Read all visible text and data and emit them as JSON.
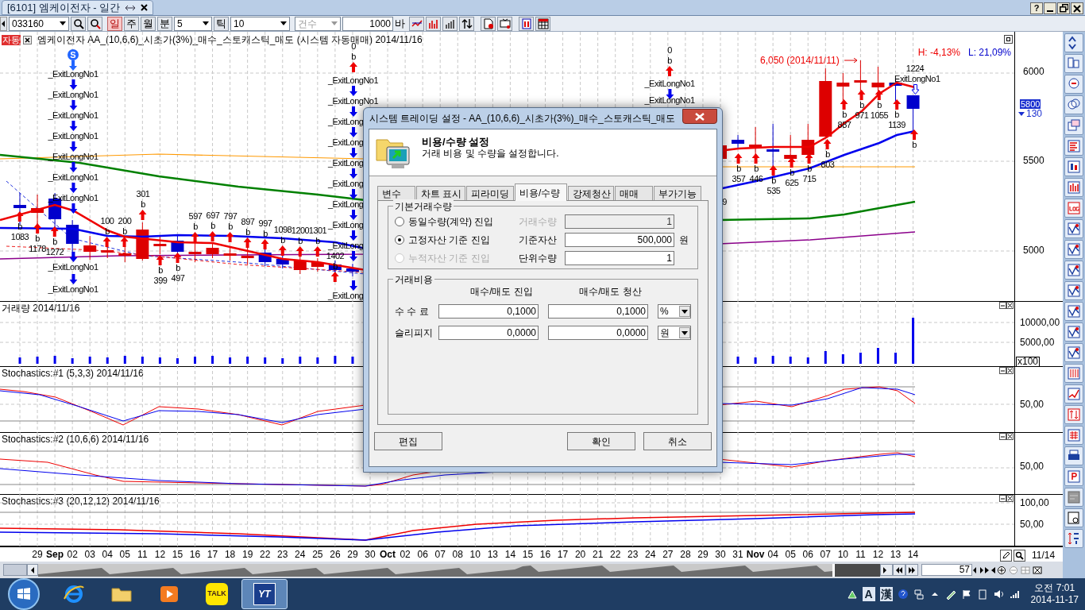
{
  "window": {
    "title": "[6101] 엠케이전자 - 일간",
    "help": "?"
  },
  "toolbar": {
    "code": "033160",
    "periods": [
      {
        "label": "일",
        "selected": true
      },
      {
        "label": "주",
        "selected": false
      },
      {
        "label": "월",
        "selected": false
      },
      {
        "label": "분",
        "selected": false
      }
    ],
    "minute": "5",
    "tick_label": "틱",
    "tick": "10",
    "count_mode": {
      "label": "건수",
      "disabled": true
    },
    "bars": "1000",
    "bars_unit": "바"
  },
  "chart": {
    "badge": "자동",
    "title": "엠케이전자 AA_(10,6,6)_시초가(3%)_매수_스토캐스틱_매도 (시스템 자동매매) 2014/11/16",
    "high": "H: -4,13%",
    "low": "L: 21,09%",
    "peak": "6,050 (2014/11/11)",
    "price_ticks": [
      "6000",
      "5500",
      "5000"
    ],
    "last_price": "5800",
    "change": "130",
    "annotations": [
      {
        "kind": "start",
        "texts": [
          "S"
        ]
      },
      {
        "kind": "exit_above",
        "texts": [
          "_ExitLongNo1"
        ]
      },
      {
        "kind": "exit_above",
        "texts": [
          "_ExitLongNo1"
        ]
      },
      {
        "kind": "exit_above",
        "texts": [
          "_ExitLongNo1"
        ]
      },
      {
        "kind": "exit_above",
        "texts": [
          "_ExitLongNo1"
        ]
      },
      {
        "kind": "exit_above",
        "texts": [
          "_ExitLongNo1"
        ]
      },
      {
        "kind": "exit_above",
        "texts": [
          "_ExitLongNo1"
        ]
      },
      {
        "kind": "exit_above",
        "texts": [
          "_ExitLongNo1"
        ]
      },
      {
        "kind": "exit_below",
        "texts": [
          "_ExitLongNo1"
        ]
      },
      {
        "kind": "exit_below",
        "texts": [
          "_ExitLongNo1"
        ]
      },
      {
        "kind": "buy_below",
        "texts": [
          "b",
          "1083"
        ]
      },
      {
        "kind": "buy_below",
        "texts": [
          "b",
          "1178"
        ]
      },
      {
        "kind": "buy_below",
        "texts": [
          "b",
          "1272"
        ]
      },
      {
        "kind": "buy_above",
        "texts": [
          "100",
          "b"
        ]
      },
      {
        "kind": "buy_above",
        "texts": [
          "200",
          "b"
        ]
      },
      {
        "kind": "buy_above",
        "texts": [
          "301",
          "b"
        ]
      },
      {
        "kind": "buy_below",
        "texts": [
          "b",
          "399"
        ]
      },
      {
        "kind": "buy_below",
        "texts": [
          "b",
          "497"
        ]
      },
      {
        "kind": "buy_above",
        "texts": [
          "597",
          "b"
        ]
      },
      {
        "kind": "buy_above",
        "texts": [
          "697",
          "b"
        ]
      },
      {
        "kind": "buy_above",
        "texts": [
          "797",
          "b"
        ]
      },
      {
        "kind": "buy_above",
        "texts": [
          "897",
          "b"
        ]
      },
      {
        "kind": "buy_above",
        "texts": [
          "997",
          "b"
        ]
      },
      {
        "kind": "buy_above",
        "texts": [
          "1098",
          "b"
        ]
      },
      {
        "kind": "buy_above",
        "texts": [
          "1200",
          "b"
        ]
      },
      {
        "kind": "buy_above",
        "texts": [
          "1301",
          "b"
        ]
      },
      {
        "kind": "buy_above",
        "texts": [
          "1402",
          "b"
        ]
      },
      {
        "kind": "buy_above",
        "texts": [
          "0",
          "b"
        ]
      },
      {
        "kind": "exit_above",
        "texts": [
          "_ExitLongNo1"
        ]
      },
      {
        "kind": "exit_above",
        "texts": [
          "_ExitLongNo1"
        ]
      },
      {
        "kind": "exit_above",
        "texts": [
          "_ExitLong"
        ]
      },
      {
        "kind": "exit_above",
        "texts": [
          "_ExitLong"
        ]
      },
      {
        "kind": "exit_above",
        "texts": [
          "_ExitLong"
        ]
      },
      {
        "kind": "exit_above",
        "texts": [
          "_ExitLong"
        ]
      },
      {
        "kind": "exit_above",
        "texts": [
          "_ExitLong"
        ]
      },
      {
        "kind": "exit_above",
        "texts": [
          "_ExitLong"
        ]
      },
      {
        "kind": "exit_above",
        "texts": [
          "_ExitLong"
        ]
      },
      {
        "kind": "exit_below",
        "texts": [
          "_ExitLong"
        ]
      },
      {
        "kind": "buy_above",
        "texts": [
          "0",
          "b"
        ]
      },
      {
        "kind": "exit_above",
        "texts": [
          "_ExitLongNo1"
        ]
      },
      {
        "kind": "label",
        "texts": [
          "_ExitLongNo1"
        ]
      },
      {
        "kind": "label",
        "texts": [
          "9"
        ]
      },
      {
        "kind": "buy_below",
        "texts": [
          "b",
          "357"
        ]
      },
      {
        "kind": "buy_below",
        "texts": [
          "b",
          "446"
        ]
      },
      {
        "kind": "buy_below",
        "texts": [
          "b",
          "535"
        ]
      },
      {
        "kind": "buy_below",
        "texts": [
          "b",
          "625"
        ]
      },
      {
        "kind": "buy_below",
        "texts": [
          "b",
          "715"
        ]
      },
      {
        "kind": "buy_below",
        "texts": [
          "b",
          "803"
        ]
      },
      {
        "kind": "buy_below",
        "texts": [
          "b",
          "887"
        ]
      },
      {
        "kind": "buy_below",
        "texts": [
          "b",
          "971"
        ]
      },
      {
        "kind": "buy_below",
        "texts": [
          "b",
          "1055"
        ]
      },
      {
        "kind": "buy_below",
        "texts": [
          "b",
          "1139"
        ]
      },
      {
        "kind": "exit_hollow",
        "texts": [
          "1224",
          "_ExitLongNo1"
        ]
      },
      {
        "kind": "buy_below",
        "texts": [
          "b"
        ]
      }
    ]
  },
  "panels": [
    {
      "title": "거래량 2014/11/16",
      "ticks": [
        "10000,00",
        "5000,00"
      ],
      "unit": "x100"
    },
    {
      "title": "Stochastics:#1  (5,3,3) 2014/11/16",
      "ticks": [
        "50,00"
      ]
    },
    {
      "title": "Stochastics:#2  (10,6,6) 2014/11/16",
      "ticks": [
        "50,00"
      ]
    },
    {
      "title": "Stochastics:#3  (20,12,12) 2014/11/16",
      "ticks": [
        "100,00",
        "50,00"
      ]
    }
  ],
  "dates": [
    {
      "label": "29",
      "kind": "day"
    },
    {
      "label": "Sep",
      "kind": "month"
    },
    {
      "label": "02",
      "kind": "day"
    },
    {
      "label": "03",
      "kind": "day"
    },
    {
      "label": "04",
      "kind": "day"
    },
    {
      "label": "05",
      "kind": "day"
    },
    {
      "label": "11",
      "kind": "day"
    },
    {
      "label": "12",
      "kind": "day"
    },
    {
      "label": "15",
      "kind": "day"
    },
    {
      "label": "16",
      "kind": "day"
    },
    {
      "label": "17",
      "kind": "day"
    },
    {
      "label": "18",
      "kind": "day"
    },
    {
      "label": "19",
      "kind": "day"
    },
    {
      "label": "22",
      "kind": "day"
    },
    {
      "label": "23",
      "kind": "day"
    },
    {
      "label": "24",
      "kind": "day"
    },
    {
      "label": "25",
      "kind": "day"
    },
    {
      "label": "26",
      "kind": "day"
    },
    {
      "label": "29",
      "kind": "day"
    },
    {
      "label": "30",
      "kind": "day"
    },
    {
      "label": "Oct",
      "kind": "month"
    },
    {
      "label": "02",
      "kind": "day"
    },
    {
      "label": "06",
      "kind": "day"
    },
    {
      "label": "07",
      "kind": "day"
    },
    {
      "label": "08",
      "kind": "day"
    },
    {
      "label": "10",
      "kind": "day"
    },
    {
      "label": "13",
      "kind": "day"
    },
    {
      "label": "14",
      "kind": "day"
    },
    {
      "label": "15",
      "kind": "day"
    },
    {
      "label": "16",
      "kind": "day"
    },
    {
      "label": "17",
      "kind": "day"
    },
    {
      "label": "20",
      "kind": "day"
    },
    {
      "label": "21",
      "kind": "day"
    },
    {
      "label": "22",
      "kind": "day"
    },
    {
      "label": "23",
      "kind": "day"
    },
    {
      "label": "24",
      "kind": "day"
    },
    {
      "label": "27",
      "kind": "day"
    },
    {
      "label": "28",
      "kind": "day"
    },
    {
      "label": "29",
      "kind": "day"
    },
    {
      "label": "30",
      "kind": "day"
    },
    {
      "label": "31",
      "kind": "day"
    },
    {
      "label": "Nov",
      "kind": "month"
    },
    {
      "label": "04",
      "kind": "day"
    },
    {
      "label": "05",
      "kind": "day"
    },
    {
      "label": "06",
      "kind": "day"
    },
    {
      "label": "07",
      "kind": "day"
    },
    {
      "label": "10",
      "kind": "day"
    },
    {
      "label": "11",
      "kind": "day"
    },
    {
      "label": "12",
      "kind": "day"
    },
    {
      "label": "13",
      "kind": "day"
    },
    {
      "label": "14",
      "kind": "day"
    }
  ],
  "navigator": {
    "last_date": "11/14",
    "bars": "57"
  },
  "dialog": {
    "title": "시스템 트레이딩 설정 - AA_(10,6,6)_시초가(3%)_매수_스토캐스틱_매도",
    "heading": "비용/수량 설정",
    "subtitle": "거래 비용 및 수량을 설정합니다.",
    "tabs": [
      {
        "label": "변수",
        "selected": false
      },
      {
        "label": "차트 표시",
        "selected": false
      },
      {
        "label": "피라미딩",
        "selected": false
      },
      {
        "label": "비용/수량",
        "selected": true
      },
      {
        "label": "강제청산",
        "selected": false
      },
      {
        "label": "매매",
        "selected": false
      },
      {
        "label": "부가기능",
        "selected": false
      }
    ],
    "quantity": {
      "legend": "기본거래수량",
      "options": [
        {
          "label": "동일수량(계약) 진입",
          "selected": false,
          "disabled": false
        },
        {
          "label": "고정자산 기준 진입",
          "selected": true,
          "disabled": false
        },
        {
          "label": "누적자산 기준 진입",
          "selected": false,
          "disabled": true
        }
      ],
      "fields": [
        {
          "label": "거래수량",
          "value": "1",
          "disabled": true
        },
        {
          "label": "기준자산",
          "value": "500,000",
          "unit": "원",
          "disabled": false
        },
        {
          "label": "단위수량",
          "value": "1",
          "disabled": false
        }
      ]
    },
    "cost": {
      "legend": "거래비용",
      "columns": [
        "매수/매도 진입",
        "매수/매도 청산"
      ],
      "rows": [
        {
          "label": "수 수 료",
          "entry": "0,1000",
          "exit": "0,1000",
          "unit": "%"
        },
        {
          "label": "슬리피지",
          "entry": "0,0000",
          "exit": "0,0000",
          "unit": "원"
        }
      ]
    },
    "buttons": [
      "편집",
      "확인",
      "취소"
    ]
  },
  "taskbar": {
    "apps": [
      {
        "kind": "browser",
        "selected": false
      },
      {
        "kind": "folder",
        "selected": false
      },
      {
        "kind": "media",
        "selected": false
      },
      {
        "kind": "talk",
        "label": "TALK",
        "selected": false
      },
      {
        "kind": "trading",
        "label": "YT",
        "selected": true
      }
    ],
    "ime": [
      "A",
      "漢"
    ],
    "time": "오전 7:01",
    "date": "2014-11-17"
  }
}
